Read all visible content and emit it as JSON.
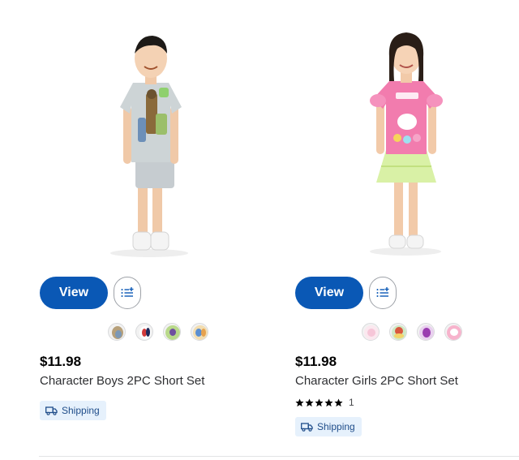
{
  "products": [
    {
      "view_label": "View",
      "price": "$11.98",
      "title": "Character Boys 2PC Short Set",
      "rating": 0,
      "review_count": "",
      "shipping_label": "Shipping",
      "swatches": [
        "toy-story-swatch",
        "mickey-swatch",
        "buzz-swatch",
        "bluey-swatch"
      ]
    },
    {
      "view_label": "View",
      "price": "$11.98",
      "title": "Character Girls 2PC Short Set",
      "rating": 5,
      "review_count": "1",
      "shipping_label": "Shipping",
      "swatches": [
        "unicorn-swatch",
        "jessie-swatch",
        "minnie-swatch",
        "hello-kitty-swatch"
      ]
    }
  ],
  "colors": {
    "primary": "#0a58b5",
    "badge_bg": "#e6f1fc",
    "badge_text": "#1f4d8a"
  }
}
